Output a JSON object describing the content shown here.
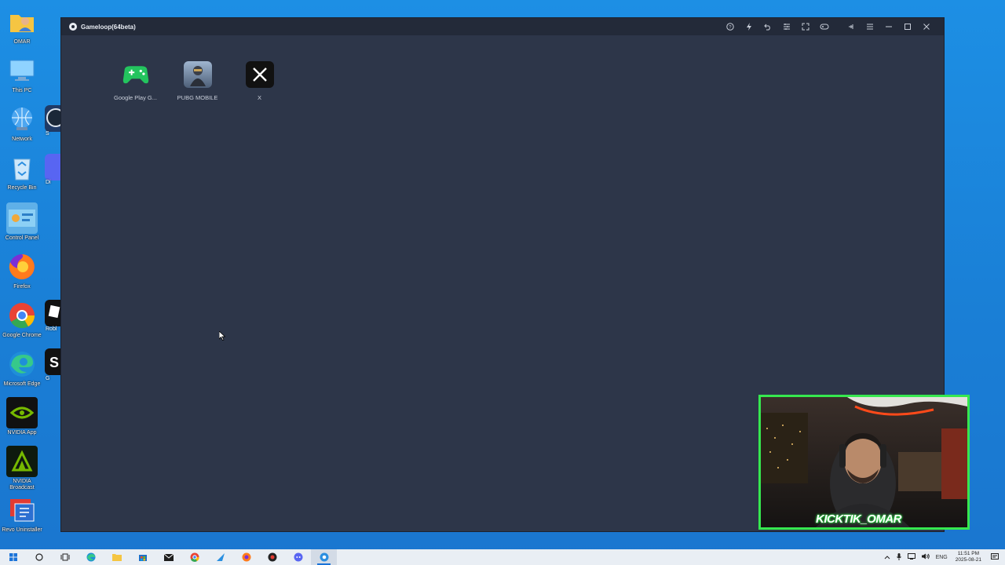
{
  "window": {
    "title": "Gameloop(64beta)",
    "toolbar_icons": [
      "help-icon",
      "boost-icon",
      "back-icon",
      "menu-list-icon",
      "fullscreen-icon",
      "controller-icon",
      "pin-icon",
      "hamburger-icon",
      "minimize-icon",
      "maximize-icon",
      "close-icon"
    ]
  },
  "apps": [
    {
      "label": "Google Play G...",
      "icon": "google-play-games-icon",
      "color": "#23c45e"
    },
    {
      "label": "PUBG MOBILE",
      "icon": "pubg-mobile-icon",
      "color": "#6f86a8"
    },
    {
      "label": "X",
      "icon": "x-icon",
      "color": "#111111"
    }
  ],
  "desktop": {
    "icons": [
      {
        "label": "OMAR",
        "icon": "user-folder-icon"
      },
      {
        "label": "This PC",
        "icon": "this-pc-icon"
      },
      {
        "label": "Network",
        "icon": "network-icon"
      },
      {
        "label": "Recycle Bin",
        "icon": "recycle-bin-icon"
      },
      {
        "label": "Control Panel",
        "icon": "control-panel-icon"
      },
      {
        "label": "Firefox",
        "icon": "firefox-icon"
      },
      {
        "label": "Google Chrome",
        "icon": "chrome-icon"
      },
      {
        "label": "Microsoft Edge",
        "icon": "edge-icon"
      },
      {
        "label": "NVIDIA App",
        "icon": "nvidia-app-icon"
      },
      {
        "label": "NVIDIA Broadcast",
        "icon": "nvidia-broadcast-icon"
      },
      {
        "label": "Revo Uninstaller",
        "icon": "revo-uninstaller-icon"
      }
    ],
    "partial_labels": [
      "S",
      "Di",
      "Robl",
      "G"
    ]
  },
  "webcam": {
    "brand_text": "KICKTIK_OMAR",
    "border_color": "#36e84f"
  },
  "taskbar": {
    "language": "ENG",
    "time": "11:51 PM",
    "date": "2025-08-21"
  }
}
